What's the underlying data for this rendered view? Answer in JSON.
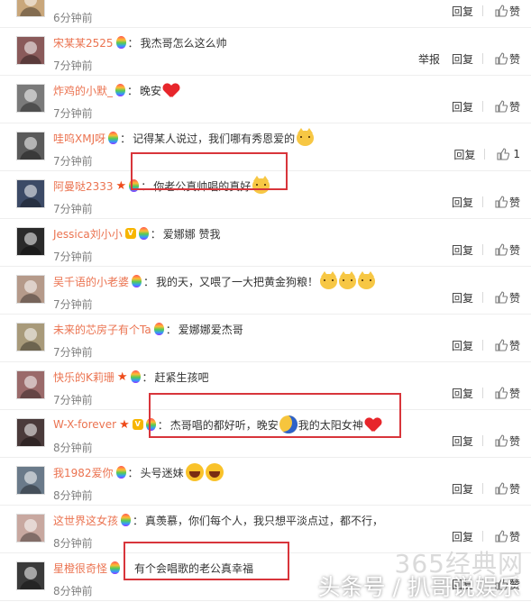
{
  "actions": {
    "report": "举报",
    "reply": "回复",
    "like": "赞"
  },
  "comments": [
    {
      "user": "",
      "text": "",
      "time": "6分钟前",
      "like_label": "赞",
      "avatar_color": "#c9a77b"
    },
    {
      "user": "宋某某2525",
      "text": "我杰哥怎么这么帅",
      "time": "7分钟前",
      "report": "举报",
      "like_label": "赞",
      "avatar_color": "#8a5a5a"
    },
    {
      "user": "炸鸡的小默_",
      "text": "晚安",
      "time": "7分钟前",
      "like_label": "赞",
      "avatar_color": "#7a7a7a",
      "emoji": [
        "heart"
      ]
    },
    {
      "user": "哇呜XMJ呀",
      "text": "记得某人说过，我们哪有秀恩爱的",
      "time": "7分钟前",
      "like_count": "1",
      "avatar_color": "#5a5a5a",
      "emoji": [
        "cat"
      ]
    },
    {
      "user": "阿曼哒2333",
      "text": "你老公真帅唱的真好",
      "time": "7分钟前",
      "like_label": "赞",
      "avatar_color": "#3c4a66",
      "star": "★",
      "emoji": [
        "cat"
      ]
    },
    {
      "user": "Jessica刘小小",
      "text": "爱娜娜 赞我",
      "time": "7分钟前",
      "like_label": "赞",
      "avatar_color": "#2a2a2a",
      "vip": "V"
    },
    {
      "user": "吴千语的小老婆",
      "text": "我的天，又喂了一大把黄金狗粮！",
      "time": "7分钟前",
      "like_label": "赞",
      "avatar_color": "#b59a8a",
      "emoji": [
        "cat",
        "cat",
        "cat"
      ]
    },
    {
      "user": "未来的芯房子有个Ta",
      "text": "爱娜娜爱杰哥",
      "time": "7分钟前",
      "like_label": "赞",
      "avatar_color": "#a89a7a"
    },
    {
      "user": "快乐的K莉珊",
      "text": "赶紧生孩吧",
      "time": "7分钟前",
      "like_label": "赞",
      "avatar_color": "#9a6a6a",
      "star": "★"
    },
    {
      "user": "W-X-forever",
      "text": "杰哥唱的都好听，晚安",
      "text2": "我的太阳女神",
      "time": "8分钟前",
      "like_label": "赞",
      "avatar_color": "#4a3a3a",
      "star": "★",
      "vip": "V"
    },
    {
      "user": "我1982爱你",
      "text": "头号迷妹",
      "time": "8分钟前",
      "like_label": "赞",
      "avatar_color": "#6a7a8a",
      "emoji": [
        "laugh",
        "laugh"
      ]
    },
    {
      "user": "这世界这女孩",
      "text": "真羡慕，你们每个人，我只想平淡点过，都不行，",
      "time": "8分钟前",
      "like_label": "赞",
      "avatar_color": "#c8a8a0"
    },
    {
      "user": "星橙很奇怪",
      "text": "有个会唱歌的老公真幸福",
      "time": "8分钟前",
      "like_label": "赞",
      "avatar_color": "#3a3a3a"
    }
  ],
  "watermark": {
    "top": "365经典网",
    "bottom": "头条号 / 扒哥说娱乐"
  }
}
